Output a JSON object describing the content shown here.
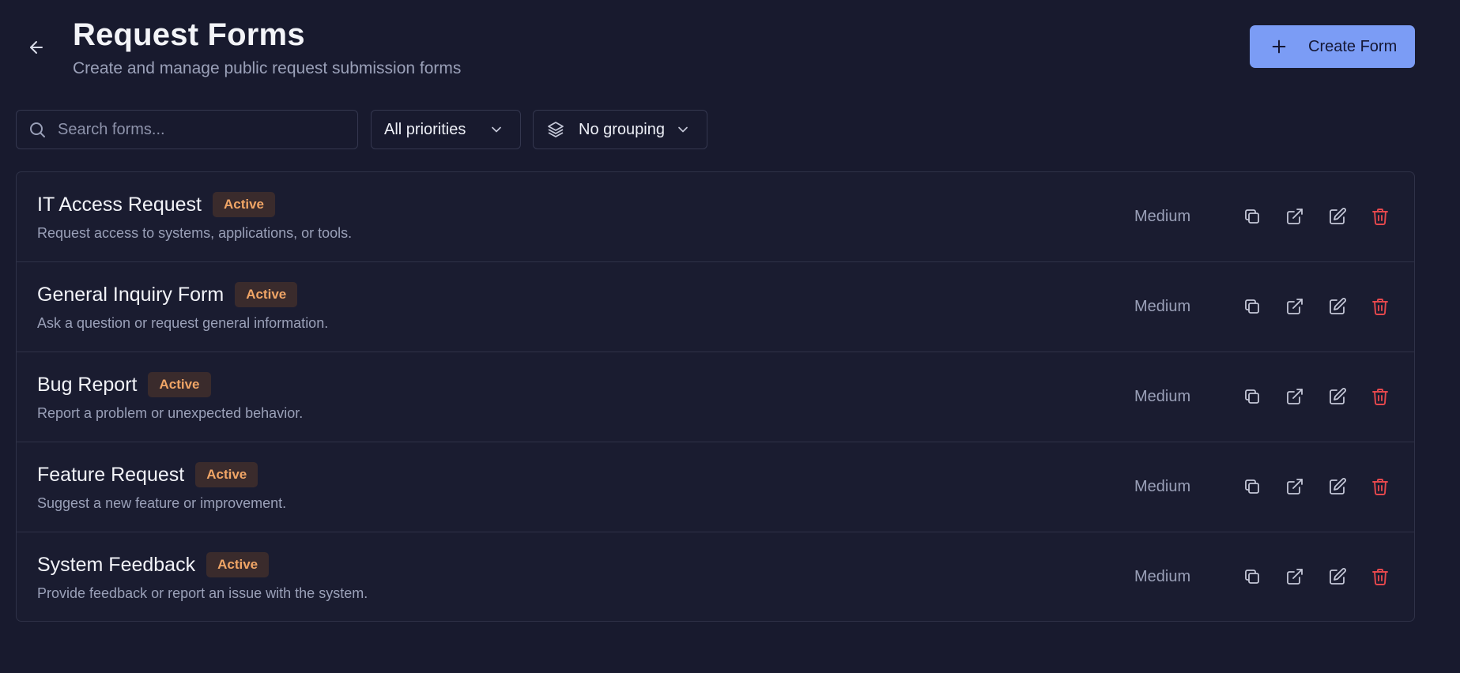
{
  "header": {
    "title": "Request Forms",
    "subtitle": "Create and manage public request submission forms",
    "back_icon": "arrow-left-icon",
    "create_label": "Create Form",
    "create_icon": "plus-icon"
  },
  "toolbar": {
    "search_placeholder": "Search forms...",
    "search_value": "",
    "priority_filter": "All priorities",
    "grouping": "No grouping"
  },
  "forms": [
    {
      "name": "IT Access Request",
      "status": "Active",
      "description": "Request access to systems, applications, or tools.",
      "priority": "Medium"
    },
    {
      "name": "General Inquiry Form",
      "status": "Active",
      "description": "Ask a question or request general information.",
      "priority": "Medium"
    },
    {
      "name": "Bug Report",
      "status": "Active",
      "description": "Report a problem or unexpected behavior.",
      "priority": "Medium"
    },
    {
      "name": "Feature Request",
      "status": "Active",
      "description": "Suggest a new feature or improvement.",
      "priority": "Medium"
    },
    {
      "name": "System Feedback",
      "status": "Active",
      "description": "Provide feedback or report an issue with the system.",
      "priority": "Medium"
    }
  ],
  "row_actions": [
    "copy-icon",
    "external-link-icon",
    "edit-icon",
    "trash-icon"
  ],
  "colors": {
    "background": "#181a2e",
    "accent": "#7b9cf5",
    "badge_text": "#f0a566",
    "badge_bg": "#3a2b2c",
    "danger": "#e5484d"
  }
}
